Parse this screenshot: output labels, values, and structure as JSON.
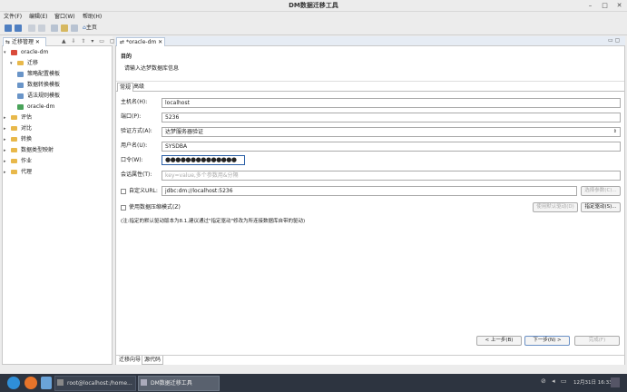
{
  "window": {
    "title": "DM数据迁移工具",
    "min": "–",
    "max": "□",
    "close": "✕"
  },
  "menu": [
    "文件(F)",
    "编辑(E)",
    "窗口(W)",
    "帮助(H)"
  ],
  "toolbar": {
    "home_label": "主页"
  },
  "left_panel": {
    "tab_label": "迁移管理",
    "tree": [
      {
        "label": "oracle-dm",
        "icon": "project-icon",
        "level": 0,
        "arrow": "▾"
      },
      {
        "label": "迁移",
        "icon": "folder-icon",
        "level": 1,
        "arrow": "▾"
      },
      {
        "label": "策略配置模板",
        "icon": "template-icon",
        "level": 2
      },
      {
        "label": "数据转换模板",
        "icon": "template-icon",
        "level": 2
      },
      {
        "label": "语法规则模板",
        "icon": "template-icon",
        "level": 2
      },
      {
        "label": "oracle-dm",
        "icon": "migration-icon",
        "level": 2
      },
      {
        "label": "评估",
        "icon": "folder-icon",
        "level": 0,
        "arrow": "▸"
      },
      {
        "label": "对比",
        "icon": "folder-icon",
        "level": 0,
        "arrow": "▸"
      },
      {
        "label": "转换",
        "icon": "folder-icon",
        "level": 0,
        "arrow": "▸"
      },
      {
        "label": "数据类型映射",
        "icon": "folder-icon",
        "level": 0,
        "arrow": "▸"
      },
      {
        "label": "作业",
        "icon": "folder-icon",
        "level": 0,
        "arrow": "▸"
      },
      {
        "label": "代理",
        "icon": "folder-icon",
        "level": 0,
        "arrow": "▸"
      }
    ]
  },
  "editor": {
    "tab_label": "*oracle-dm",
    "header_title": "目的",
    "header_desc": "请输入达梦数据库信息",
    "inner_tabs": [
      "常规",
      "高级"
    ],
    "fields": {
      "host_label": "主机名(H):",
      "host_value": "localhost",
      "port_label": "端口(P):",
      "port_value": "5236",
      "auth_label": "验证方式(A):",
      "auth_value": "达梦服务器验证",
      "user_label": "用户名(U):",
      "user_value": "SYSDBA",
      "pwd_label": "口令(W):",
      "pwd_value": "●●●●●●●●●●●●●●",
      "session_label": "会话属性(T):",
      "session_placeholder": "key=value,多个参数用&分隔",
      "custom_url_label": "自定义URL:",
      "custom_url_value": "jdbc:dm://localhost:5236",
      "select_params_btn": "选择参数(C)...",
      "compress_label": "使用数据压缩模式(Z)",
      "default_driver_btn": "使用默认驱动(D)",
      "specify_driver_btn": "指定驱动(S)...",
      "note": "(注:指定的默认驱动版本为8.1,建议通过\"指定驱动\"修改为所连接数据库自带的驱动)"
    },
    "buttons": {
      "back": "< 上一步(B)",
      "next": "下一步(N) >",
      "finish": "完成(F)"
    },
    "bottom_tabs": [
      "迁移向导",
      "源代码"
    ]
  },
  "taskbar": {
    "items": [
      "root@localhost:/home...",
      "DM数据迁移工具"
    ],
    "clock": "12月31日 16:33"
  },
  "colors": {
    "accent": "#2a5fa6",
    "taskbar": "#2d3440"
  }
}
